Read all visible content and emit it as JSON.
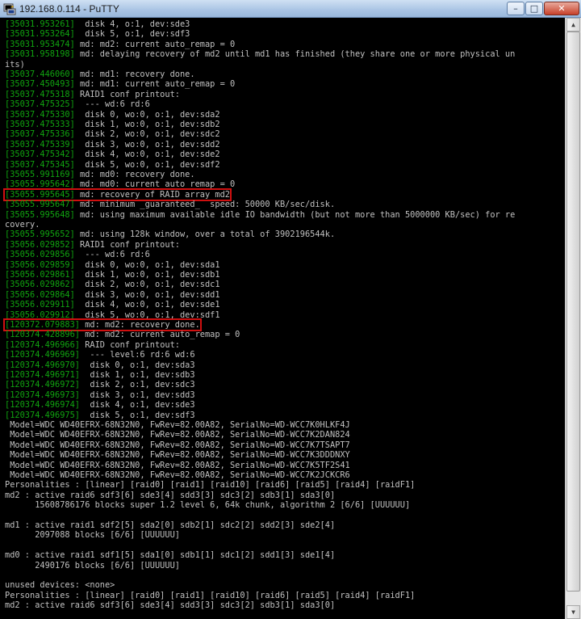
{
  "window": {
    "title": "192.168.0.114 - PuTTY",
    "min_label": "–",
    "max_label": "□",
    "close_label": "✕"
  },
  "console": {
    "lines": [
      {
        "ts": "[35031.953261]",
        "msg": "  disk 4, o:1, dev:sde3"
      },
      {
        "ts": "[35031.953264]",
        "msg": "  disk 5, o:1, dev:sdf3"
      },
      {
        "ts": "[35031.953474]",
        "msg": " md: md2: current auto_remap = 0"
      },
      {
        "ts": "[35031.958198]",
        "msg": " md: delaying recovery of md2 until md1 has finished (they share one or more physical un"
      },
      {
        "ts": "",
        "msg": "its)"
      },
      {
        "ts": "[35037.446060]",
        "msg": " md: md1: recovery done."
      },
      {
        "ts": "[35037.450493]",
        "msg": " md: md1: current auto_remap = 0"
      },
      {
        "ts": "[35037.475318]",
        "msg": " RAID1 conf printout:"
      },
      {
        "ts": "[35037.475325]",
        "msg": "  --- wd:6 rd:6"
      },
      {
        "ts": "[35037.475330]",
        "msg": "  disk 0, wo:0, o:1, dev:sda2"
      },
      {
        "ts": "[35037.475333]",
        "msg": "  disk 1, wo:0, o:1, dev:sdb2"
      },
      {
        "ts": "[35037.475336]",
        "msg": "  disk 2, wo:0, o:1, dev:sdc2"
      },
      {
        "ts": "[35037.475339]",
        "msg": "  disk 3, wo:0, o:1, dev:sdd2"
      },
      {
        "ts": "[35037.475342]",
        "msg": "  disk 4, wo:0, o:1, dev:sde2"
      },
      {
        "ts": "[35037.475345]",
        "msg": "  disk 5, wo:0, o:1, dev:sdf2"
      },
      {
        "ts": "[35055.991169]",
        "msg": " md: md0: recovery done."
      },
      {
        "ts": "[35055.995642]",
        "msg": " md: md0: current auto_remap = 0"
      },
      {
        "ts": "[35055.995645]",
        "msg": " md: recovery of RAID array md2",
        "highlight": true
      },
      {
        "ts": "[35055.995647]",
        "msg": " md: minimum _guaranteed_  speed: 50000 KB/sec/disk."
      },
      {
        "ts": "[35055.995648]",
        "msg": " md: using maximum available idle IO bandwidth (but not more than 5000000 KB/sec) for re"
      },
      {
        "ts": "",
        "msg": "covery."
      },
      {
        "ts": "[35055.995652]",
        "msg": " md: using 128k window, over a total of 3902196544k."
      },
      {
        "ts": "[35056.029852]",
        "msg": " RAID1 conf printout:"
      },
      {
        "ts": "[35056.029856]",
        "msg": "  --- wd:6 rd:6"
      },
      {
        "ts": "[35056.029859]",
        "msg": "  disk 0, wo:0, o:1, dev:sda1"
      },
      {
        "ts": "[35056.029861]",
        "msg": "  disk 1, wo:0, o:1, dev:sdb1"
      },
      {
        "ts": "[35056.029862]",
        "msg": "  disk 2, wo:0, o:1, dev:sdc1"
      },
      {
        "ts": "[35056.029864]",
        "msg": "  disk 3, wo:0, o:1, dev:sdd1"
      },
      {
        "ts": "[35056.029911]",
        "msg": "  disk 4, wo:0, o:1, dev:sde1"
      },
      {
        "ts": "[35056.029912]",
        "msg": "  disk 5, wo:0, o:1, dev:sdf1"
      },
      {
        "ts": "[120372.079883]",
        "msg": " md: md2: recovery done.",
        "highlight": true
      },
      {
        "ts": "[120374.428896]",
        "msg": " md: md2: current auto_remap = 0"
      },
      {
        "ts": "[120374.496966]",
        "msg": " RAID conf printout:"
      },
      {
        "ts": "[120374.496969]",
        "msg": "  --- level:6 rd:6 wd:6"
      },
      {
        "ts": "[120374.496970]",
        "msg": "  disk 0, o:1, dev:sda3"
      },
      {
        "ts": "[120374.496971]",
        "msg": "  disk 1, o:1, dev:sdb3"
      },
      {
        "ts": "[120374.496972]",
        "msg": "  disk 2, o:1, dev:sdc3"
      },
      {
        "ts": "[120374.496973]",
        "msg": "  disk 3, o:1, dev:sdd3"
      },
      {
        "ts": "[120374.496974]",
        "msg": "  disk 4, o:1, dev:sde3"
      },
      {
        "ts": "[120374.496975]",
        "msg": "  disk 5, o:1, dev:sdf3"
      },
      {
        "ts": "",
        "msg": " Model=WDC WD40EFRX-68N32N0, FwRev=82.00A82, SerialNo=WD-WCC7K0HLKF4J"
      },
      {
        "ts": "",
        "msg": " Model=WDC WD40EFRX-68N32N0, FwRev=82.00A82, SerialNo=WD-WCC7K2DAN824"
      },
      {
        "ts": "",
        "msg": " Model=WDC WD40EFRX-68N32N0, FwRev=82.00A82, SerialNo=WD-WCC7K7TSAPT7"
      },
      {
        "ts": "",
        "msg": " Model=WDC WD40EFRX-68N32N0, FwRev=82.00A82, SerialNo=WD-WCC7K3DDDNXY"
      },
      {
        "ts": "",
        "msg": " Model=WDC WD40EFRX-68N32N0, FwRev=82.00A82, SerialNo=WD-WCC7K5TF2S41"
      },
      {
        "ts": "",
        "msg": " Model=WDC WD40EFRX-68N32N0, FwRev=82.00A82, SerialNo=WD-WCC7K2JCKCR6"
      },
      {
        "ts": "",
        "msg": "Personalities : [linear] [raid0] [raid1] [raid10] [raid6] [raid5] [raid4] [raidF1]"
      },
      {
        "ts": "",
        "msg": "md2 : active raid6 sdf3[6] sde3[4] sdd3[3] sdc3[2] sdb3[1] sda3[0]"
      },
      {
        "ts": "",
        "msg": "      15608786176 blocks super 1.2 level 6, 64k chunk, algorithm 2 [6/6] [UUUUUU]"
      },
      {
        "ts": "",
        "msg": ""
      },
      {
        "ts": "",
        "msg": "md1 : active raid1 sdf2[5] sda2[0] sdb2[1] sdc2[2] sdd2[3] sde2[4]"
      },
      {
        "ts": "",
        "msg": "      2097088 blocks [6/6] [UUUUUU]"
      },
      {
        "ts": "",
        "msg": ""
      },
      {
        "ts": "",
        "msg": "md0 : active raid1 sdf1[5] sda1[0] sdb1[1] sdc1[2] sdd1[3] sde1[4]"
      },
      {
        "ts": "",
        "msg": "      2490176 blocks [6/6] [UUUUUU]"
      },
      {
        "ts": "",
        "msg": ""
      },
      {
        "ts": "",
        "msg": "unused devices: <none>"
      },
      {
        "ts": "",
        "msg": "Personalities : [linear] [raid0] [raid1] [raid10] [raid6] [raid5] [raid4] [raidF1]"
      },
      {
        "ts": "",
        "msg": "md2 : active raid6 sdf3[6] sde3[4] sdd3[3] sdc3[2] sdb3[1] sda3[0]"
      }
    ]
  },
  "colors": {
    "timestamp": "#10a410",
    "text": "#c0c0c0",
    "highlight_border": "#d01010",
    "background": "#000000"
  }
}
